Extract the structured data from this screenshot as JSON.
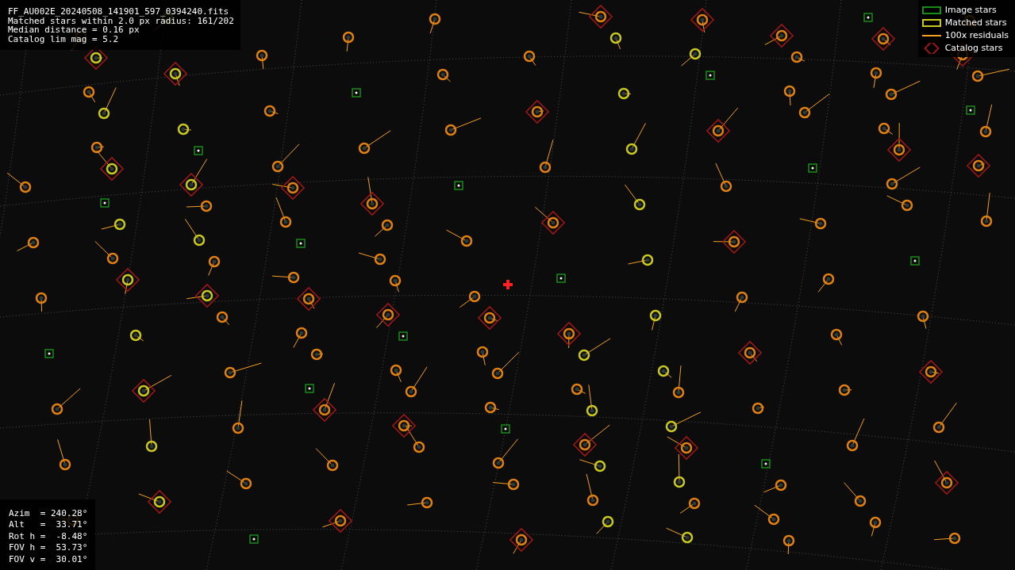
{
  "info": {
    "lines": [
      "FF_AU002E_20240508_141901_597_0394240.fits",
      "Matched stars within 2.0 px radius: 161/202",
      "Median distance = 0.16 px",
      "Catalog lim mag = 5.2"
    ]
  },
  "legend": [
    {
      "kind": "image",
      "label": "Image stars"
    },
    {
      "kind": "matched",
      "label": "Matched stars"
    },
    {
      "kind": "residual",
      "label": "100x residuals"
    },
    {
      "kind": "catalog",
      "label": "Catalog stars"
    }
  ],
  "pointing": {
    "lines": [
      "Azim  = 240.28°",
      "Alt   =  33.71°",
      "Rot h =  -8.48°",
      "FOV h =  53.73°",
      "FOV v =  30.01°"
    ]
  }
}
